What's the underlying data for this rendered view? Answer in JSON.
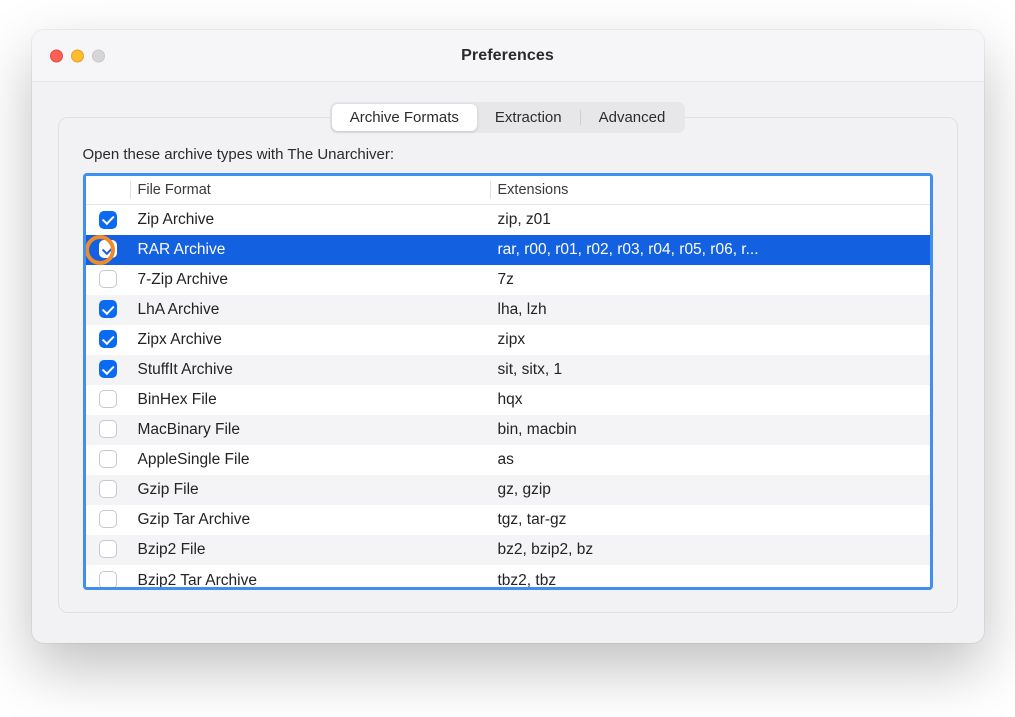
{
  "window": {
    "title": "Preferences"
  },
  "tabs": {
    "items": [
      "Archive Formats",
      "Extraction",
      "Advanced"
    ],
    "active_index": 0
  },
  "panel": {
    "label": "Open these archive types with The Unarchiver:",
    "columns": {
      "format": "File Format",
      "extensions": "Extensions"
    },
    "rows": [
      {
        "checked": true,
        "format": "Zip Archive",
        "extensions": "zip, z01"
      },
      {
        "checked": true,
        "format": "RAR Archive",
        "extensions": "rar, r00, r01, r02, r03, r04, r05, r06, r...",
        "selected": true,
        "highlight_checkbox": true
      },
      {
        "checked": false,
        "format": "7-Zip Archive",
        "extensions": "7z"
      },
      {
        "checked": true,
        "format": "LhA Archive",
        "extensions": "lha, lzh"
      },
      {
        "checked": true,
        "format": "Zipx Archive",
        "extensions": "zipx"
      },
      {
        "checked": true,
        "format": "StuffIt Archive",
        "extensions": "sit, sitx, 1"
      },
      {
        "checked": false,
        "format": "BinHex File",
        "extensions": "hqx"
      },
      {
        "checked": false,
        "format": "MacBinary File",
        "extensions": "bin, macbin"
      },
      {
        "checked": false,
        "format": "AppleSingle File",
        "extensions": "as"
      },
      {
        "checked": false,
        "format": "Gzip File",
        "extensions": "gz, gzip"
      },
      {
        "checked": false,
        "format": "Gzip Tar Archive",
        "extensions": "tgz, tar-gz"
      },
      {
        "checked": false,
        "format": "Bzip2 File",
        "extensions": "bz2, bzip2, bz"
      },
      {
        "checked": false,
        "format": "Bzip2 Tar Archive",
        "extensions": "tbz2, tbz",
        "cutoff": true
      }
    ]
  }
}
